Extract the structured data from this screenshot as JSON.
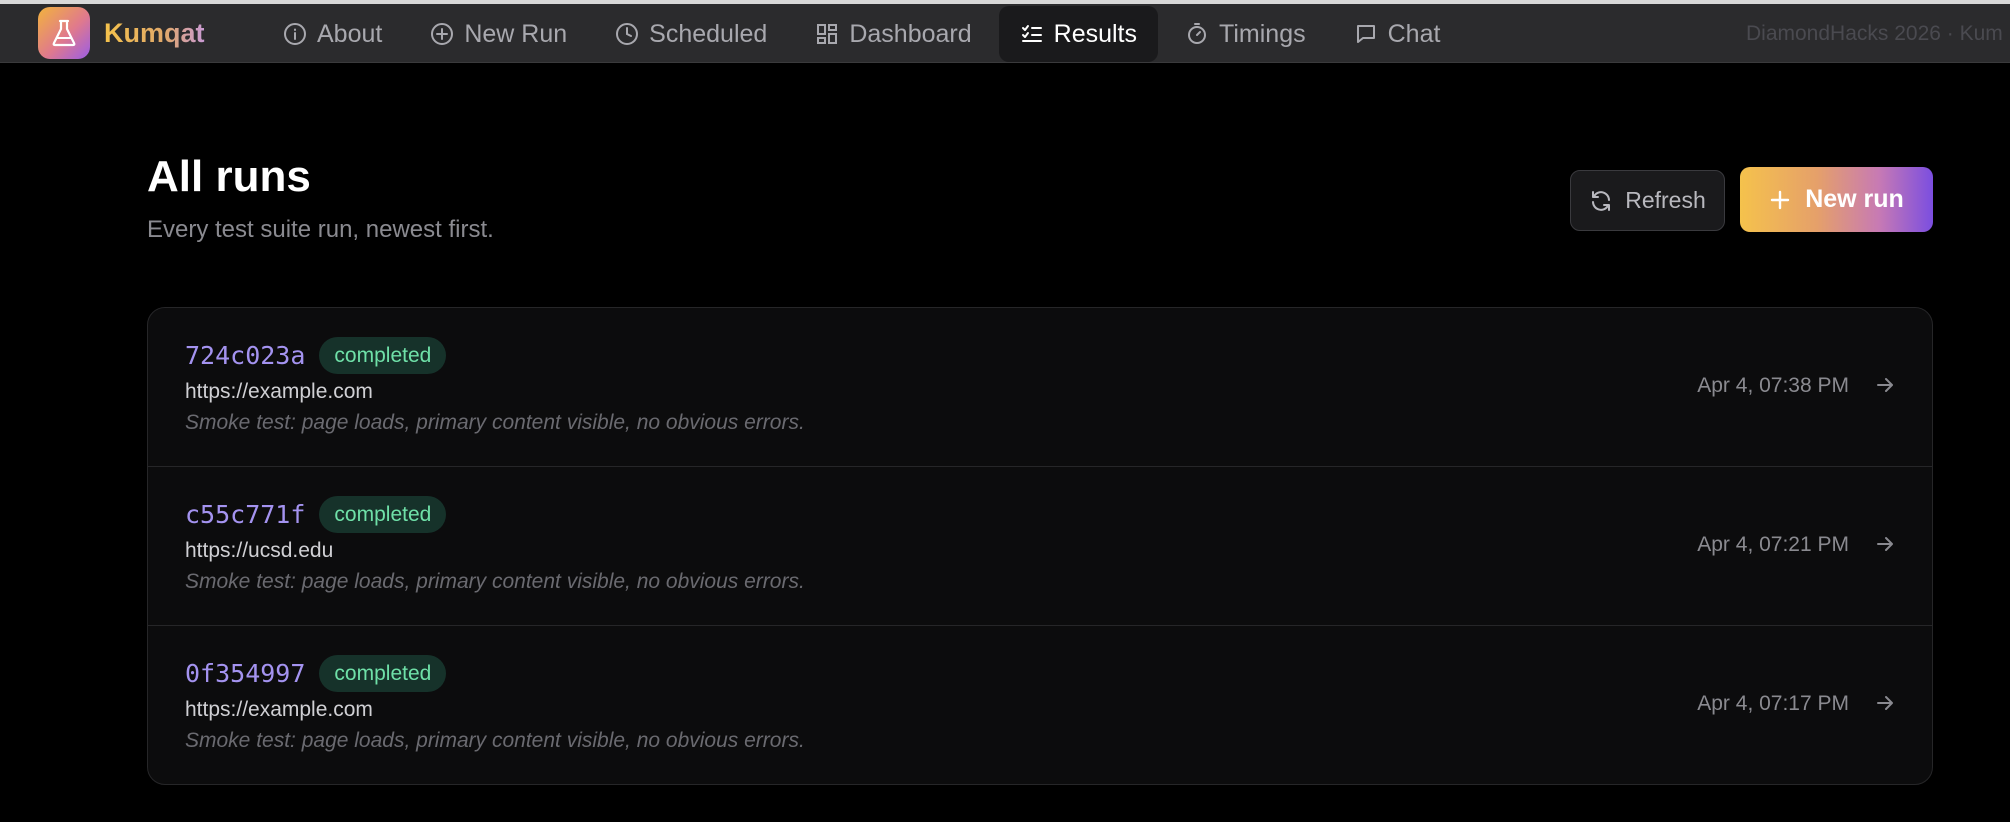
{
  "brand": {
    "name": "Kumqat"
  },
  "nav": {
    "items": [
      {
        "label": "About",
        "icon": "info-icon"
      },
      {
        "label": "New Run",
        "icon": "plus-circle-icon"
      },
      {
        "label": "Scheduled",
        "icon": "clock-icon"
      },
      {
        "label": "Dashboard",
        "icon": "grid-icon"
      },
      {
        "label": "Results",
        "icon": "checklist-icon",
        "active": true
      },
      {
        "label": "Timings",
        "icon": "stopwatch-icon"
      },
      {
        "label": "Chat",
        "icon": "chat-icon"
      }
    ],
    "right_text": "DiamondHacks 2026 · Kum"
  },
  "page": {
    "title": "All runs",
    "subtitle": "Every test suite run, newest first."
  },
  "actions": {
    "refresh_label": "Refresh",
    "new_run_label": "New run"
  },
  "runs": [
    {
      "id": "724c023a",
      "status": "completed",
      "url": "https://example.com",
      "description": "Smoke test: page loads, primary content visible, no obvious errors.",
      "time": "Apr 4, 07:38 PM"
    },
    {
      "id": "c55c771f",
      "status": "completed",
      "url": "https://ucsd.edu",
      "description": "Smoke test: page loads, primary content visible, no obvious errors.",
      "time": "Apr 4, 07:21 PM"
    },
    {
      "id": "0f354997",
      "status": "completed",
      "url": "https://example.com",
      "description": "Smoke test: page loads, primary content visible, no obvious errors.",
      "time": "Apr 4, 07:17 PM"
    }
  ],
  "colors": {
    "accent": "#a493f0",
    "status_completed": "#6fe0a8",
    "brand_gradient_start": "#f5c24c",
    "brand_gradient_end": "#7b4ee0"
  }
}
